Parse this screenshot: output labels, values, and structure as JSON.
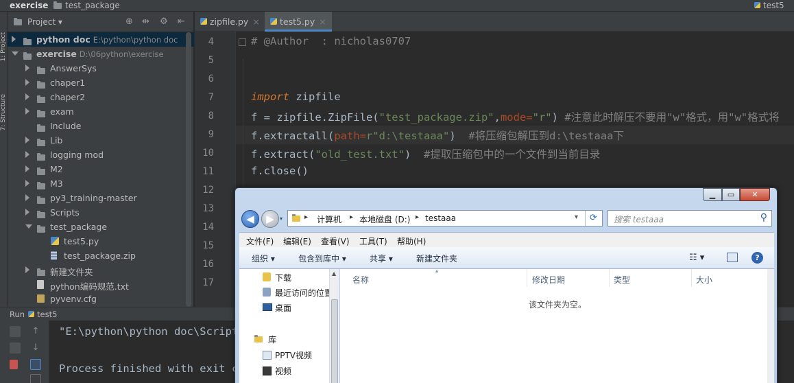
{
  "navbar": {
    "crumb_exercise": "exercise",
    "crumb_package": "test_package",
    "right_file": "test5"
  },
  "left_strip": {
    "label_1": "1: Project",
    "label_2": "7: Structure"
  },
  "project": {
    "title": "Project",
    "header_icons": [
      "target-icon",
      "collapse-icon",
      "gear-icon",
      "hide-icon"
    ],
    "rows": [
      {
        "name": "python doc",
        "path": "E:\\python\\python doc",
        "level": 0,
        "arrow": "right",
        "kind": "folder",
        "selected": true
      },
      {
        "name": "exercise",
        "path": "D:\\06python\\exercise",
        "level": 0,
        "arrow": "down",
        "kind": "folder",
        "selected": false
      },
      {
        "name": "AnswerSys",
        "level": 1,
        "arrow": "right",
        "kind": "folder"
      },
      {
        "name": "chaper1",
        "level": 1,
        "arrow": "right",
        "kind": "folder"
      },
      {
        "name": "chaper2",
        "level": 1,
        "arrow": "right",
        "kind": "folder"
      },
      {
        "name": "exam",
        "level": 1,
        "arrow": "right",
        "kind": "folder"
      },
      {
        "name": "Include",
        "level": 1,
        "arrow": "none",
        "kind": "folder"
      },
      {
        "name": "Lib",
        "level": 1,
        "arrow": "right",
        "kind": "folder"
      },
      {
        "name": "logging mod",
        "level": 1,
        "arrow": "right",
        "kind": "folder"
      },
      {
        "name": "M2",
        "level": 1,
        "arrow": "right",
        "kind": "folder"
      },
      {
        "name": "M3",
        "level": 1,
        "arrow": "right",
        "kind": "folder"
      },
      {
        "name": "py3_training-master",
        "level": 1,
        "arrow": "right",
        "kind": "folder"
      },
      {
        "name": "Scripts",
        "level": 1,
        "arrow": "right",
        "kind": "folder"
      },
      {
        "name": "test_package",
        "level": 1,
        "arrow": "down",
        "kind": "folder"
      },
      {
        "name": "test5.py",
        "level": 2,
        "arrow": "none",
        "kind": "py"
      },
      {
        "name": "test_package.zip",
        "level": 2,
        "arrow": "none",
        "kind": "zip"
      },
      {
        "name": "新建文件夹",
        "level": 1,
        "arrow": "right",
        "kind": "folder"
      },
      {
        "name": "python编码规范.txt",
        "level": 1,
        "arrow": "none",
        "kind": "file"
      },
      {
        "name": "pyvenv.cfg",
        "level": 1,
        "arrow": "none",
        "kind": "cfg"
      }
    ]
  },
  "tabs": [
    {
      "label": "zipfile.py",
      "close": "×",
      "active": false
    },
    {
      "label": "test5.py",
      "close": "×",
      "active": true
    }
  ],
  "editor": {
    "line_numbers": [
      "4",
      "5",
      "6",
      "7",
      "8",
      "9",
      "10",
      "11",
      "12",
      "13",
      "14",
      "15",
      "16",
      "17"
    ],
    "code": {
      "l4": "# @Author  : nicholas0707",
      "l7_kw": "import",
      "l7_rest": " zipfile",
      "l8_a": "f = zipfile.ZipFile(",
      "l8_s1": "\"test_package.zip\"",
      "l8_b": ",",
      "l8_p": "mode=",
      "l8_s2": "\"r\"",
      "l8_c": ") ",
      "l8_cm": "#注意此时解压不要用\"w\"格式，用\"w\"格式将",
      "l9_a": "f.extractall(",
      "l9_p": "path=",
      "l9_s": "r\"d:\\testaaa\"",
      "l9_b": ")  ",
      "l9_cm": "#将压缩包解压到d:\\testaaa下",
      "l10_a": "f.extract(",
      "l10_s": "\"old_test.txt\"",
      "l10_b": ")  ",
      "l10_cm": "#提取压缩包中的一个文件到当前目录",
      "l11": "f.close()"
    }
  },
  "run": {
    "label": "Run",
    "config": "test5",
    "line1": "\"E:\\python\\python doc\\Scripts",
    "line2": "Process finished with exit co"
  },
  "explorer": {
    "window_buttons": {
      "minimize": "▁",
      "maximize": "▭",
      "close": "✕"
    },
    "back": "◀",
    "forward": "▶",
    "address": [
      "计算机",
      "本地磁盘 (D:)",
      "testaaa"
    ],
    "address_sep": "▸",
    "refresh": "⟳",
    "search_placeholder": "搜索 testaaa",
    "menu": [
      "文件(F)",
      "编辑(E)",
      "查看(V)",
      "工具(T)",
      "帮助(H)"
    ],
    "commands": [
      "组织 ▾",
      "包含到库中 ▾",
      "共享 ▾",
      "新建文件夹"
    ],
    "nav_items": [
      "下载",
      "最近访问的位置",
      "桌面",
      "库",
      "PPTV视频",
      "视频"
    ],
    "columns": [
      "名称",
      "修改日期",
      "类型",
      "大小"
    ],
    "empty_text": "该文件夹为空。"
  },
  "colors": {
    "ide_bg": "#2b2b2b",
    "panel_bg": "#3c3f41",
    "selection": "#0d293e",
    "keyword": "#cc7832",
    "string": "#6a8759",
    "comment": "#808080",
    "param": "#aa4926"
  }
}
